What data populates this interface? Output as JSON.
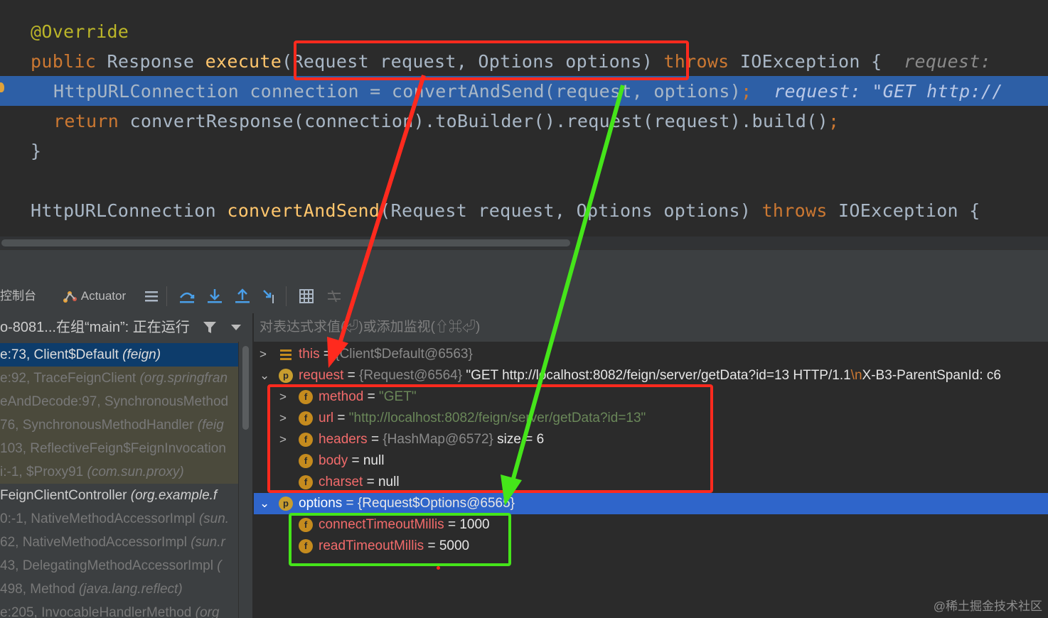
{
  "editor": {
    "line1": "@Override",
    "line2": {
      "kw": "public",
      "type": "Response",
      "method": "execute",
      "params": "(Request request, Options options)",
      "throws": "throws",
      "rest": "IOException {",
      "hint": "request:"
    },
    "line3": {
      "code": "HttpURLConnection connection = convertAndSend(request, options)",
      "semi": ";",
      "hint": "request: \"GET http://"
    },
    "line4": {
      "kw": "return",
      "code": "convertResponse(connection).toBuilder().request(request).build()",
      "semi": ";"
    },
    "line5": "}",
    "line7": {
      "type": "HttpURLConnection",
      "method": "convertAndSend",
      "params": "(Request request, Options options)",
      "throws": "throws",
      "rest": "IOException {"
    }
  },
  "toolbar": {
    "console_label": "控制台",
    "actuator_label": "Actuator",
    "icons": [
      "lines-icon",
      "step-over-icon",
      "step-into-icon",
      "step-out-icon",
      "run-to-cursor-icon",
      "evaluate-icon",
      "trace-icon"
    ]
  },
  "frames_header": "o-8081...在组“main”: 正在运行",
  "frames": [
    {
      "loc": "e:73, Client$Default ",
      "pkg": "(feign)"
    },
    {
      "loc": "e:92, TraceFeignClient ",
      "pkg": "(org.springfran"
    },
    {
      "loc": "eAndDecode:97, SynchronousMethod",
      "pkg": ""
    },
    {
      "loc": "76, SynchronousMethodHandler ",
      "pkg": "(feig"
    },
    {
      "loc": "103, ReflectiveFeign$FeignInvocation",
      "pkg": ""
    },
    {
      "loc": "i:-1, $Proxy91 ",
      "pkg": "(com.sun.proxy)"
    },
    {
      "loc": " FeignClientController ",
      "pkg": "(org.example.f"
    },
    {
      "loc": "0:-1, NativeMethodAccessorImpl ",
      "pkg": "(sun."
    },
    {
      "loc": "62, NativeMethodAccessorImpl ",
      "pkg": "(sun.r"
    },
    {
      "loc": "43, DelegatingMethodAccessorImpl ",
      "pkg": "("
    },
    {
      "loc": "498, Method ",
      "pkg": "(java.lang.reflect)"
    },
    {
      "loc": "e:205, InvocableHandlerMethod ",
      "pkg": "(org"
    }
  ],
  "eval_placeholder": "对表达式求值(⏎)或添加监视(⇧⌘⏎)",
  "variables": {
    "this": {
      "name": "this",
      "eq": " = ",
      "value": "{Client$Default@6563}"
    },
    "request": {
      "name": "request",
      "eq": " = ",
      "ref": "{Request@6564}",
      "value": " \"GET http://localhost:8082/feign/server/getData?id=13 HTTP/1.1",
      "escape": "\\n",
      "value2": "X-B3-ParentSpanId: c6"
    },
    "method": {
      "name": "method",
      "eq": " = ",
      "value": "\"GET\""
    },
    "url": {
      "name": "url",
      "eq": " = ",
      "value": "\"http://localhost:8082/feign/server/getData?id=13\""
    },
    "headers": {
      "name": "headers",
      "eq": " = ",
      "ref": "{HashMap@6572}",
      "value": "  size = 6"
    },
    "body": {
      "name": "body",
      "eq": " = ",
      "value": "null"
    },
    "charset": {
      "name": "charset",
      "eq": " = ",
      "value": "null"
    },
    "options": {
      "name": "options",
      "eq": " = ",
      "value": "{Request$Options@6565}"
    },
    "connectTimeoutMillis": {
      "name": "connectTimeoutMillis",
      "eq": " = ",
      "value": "1000"
    },
    "readTimeoutMillis": {
      "name": "readTimeoutMillis",
      "eq": " = ",
      "value": "5000"
    }
  },
  "badges": {
    "field": "f",
    "param": "p"
  },
  "watermark": "@稀土掘金技术社区",
  "colors": {
    "annotation_red": "#ff2a1e",
    "annotation_green": "#45e51a",
    "selection": "#2f65ca"
  }
}
